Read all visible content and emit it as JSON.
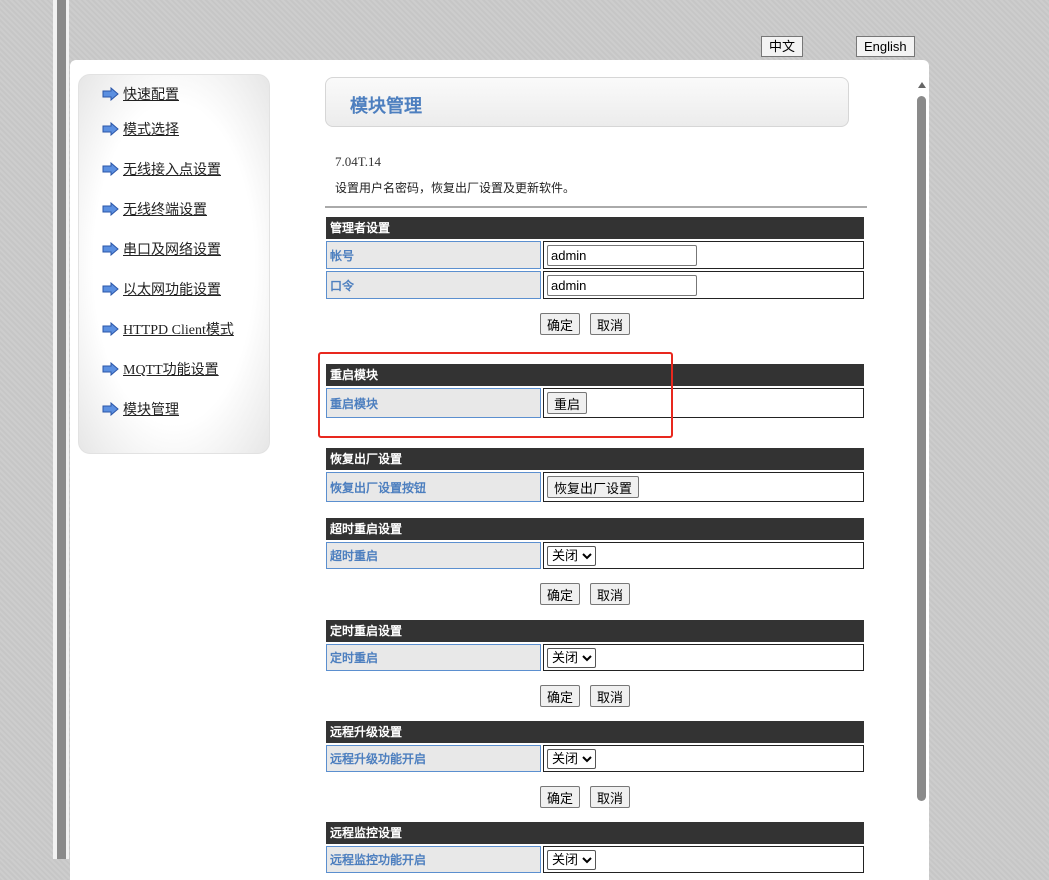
{
  "lang": {
    "zh": "中文",
    "en": "English"
  },
  "sidebar": {
    "items": [
      {
        "label": "快速配置"
      },
      {
        "label": "模式选择"
      },
      {
        "label": "无线接入点设置"
      },
      {
        "label": "无线终端设置"
      },
      {
        "label": "串口及网络设置"
      },
      {
        "label": "以太网功能设置"
      },
      {
        "label": "HTTPD Client模式"
      },
      {
        "label": "MQTT功能设置"
      },
      {
        "label": "模块管理"
      }
    ]
  },
  "main": {
    "title": "模块管理",
    "version": "7.04T.14",
    "description": "设置用户名密码，恢复出厂设置及更新软件。",
    "admin": {
      "header": "管理者设置",
      "account_label": "帐号",
      "account_value": "admin",
      "password_label": "口令",
      "password_value": "admin",
      "ok": "确定",
      "cancel": "取消"
    },
    "restart": {
      "header": "重启模块",
      "label": "重启模块",
      "button": "重启"
    },
    "factory": {
      "header": "恢复出厂设置",
      "label": "恢复出厂设置按钮",
      "button": "恢复出厂设置"
    },
    "timeout_restart": {
      "header": "超时重启设置",
      "label": "超时重启",
      "value": "关闭",
      "ok": "确定",
      "cancel": "取消"
    },
    "timed_restart": {
      "header": "定时重启设置",
      "label": "定时重启",
      "value": "关闭",
      "ok": "确定",
      "cancel": "取消"
    },
    "remote_upgrade": {
      "header": "远程升级设置",
      "label": "远程升级功能开启",
      "value": "关闭",
      "ok": "确定",
      "cancel": "取消"
    },
    "remote_monitor": {
      "header": "远程监控设置",
      "label": "远程监控功能开启",
      "value": "关闭"
    }
  }
}
